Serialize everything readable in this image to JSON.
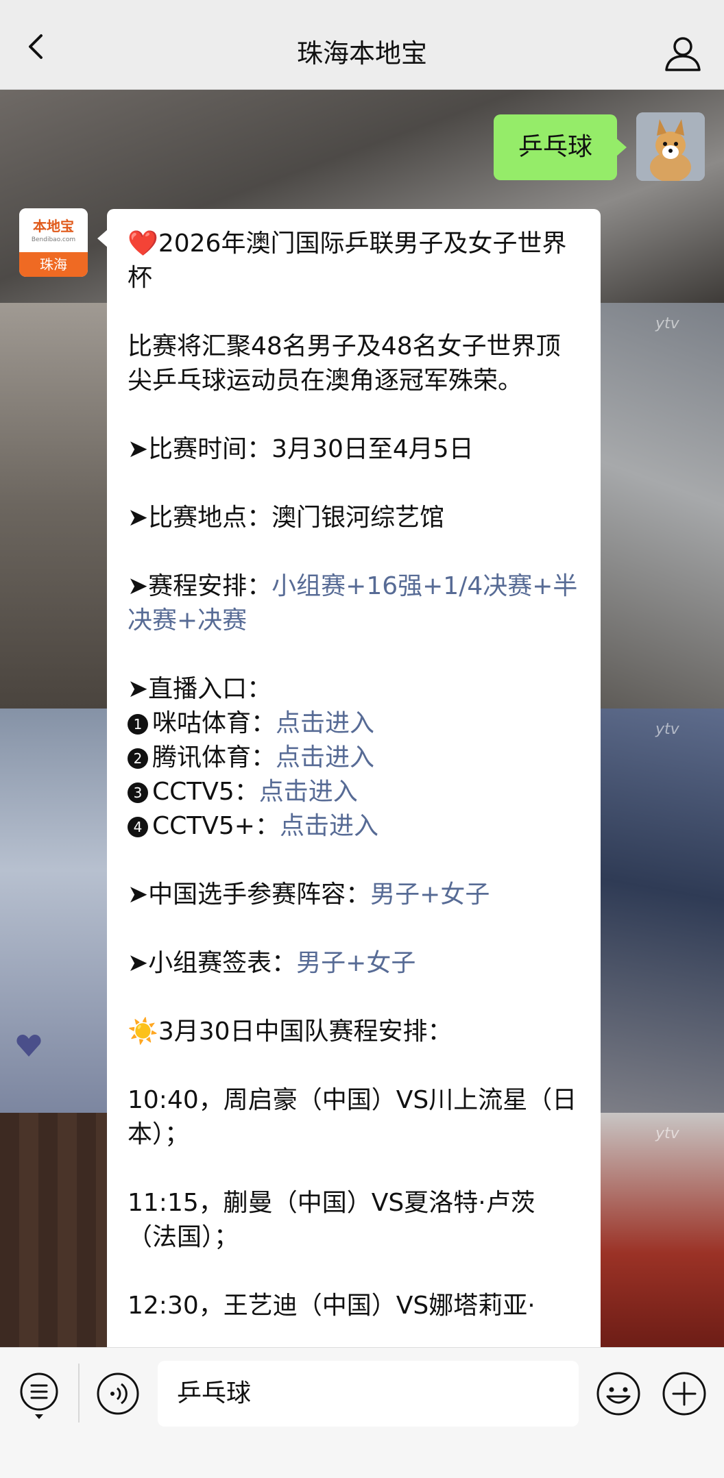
{
  "header": {
    "title": "珠海本地宝",
    "back_icon": "chevron-left-icon",
    "profile_icon": "person-icon"
  },
  "background": {
    "watermark": "ytv"
  },
  "user_message": {
    "text": "乒乓球"
  },
  "bot": {
    "avatar_top": "本地宝",
    "avatar_domain": "Bendibao.com",
    "avatar_bottom": "珠海"
  },
  "message": {
    "title_emoji": "❤️",
    "title": "2026年澳门国际乒联男子及女子世界杯",
    "intro": "比赛将汇聚48名男子及48名女子世界顶尖乒乓球运动员在澳角逐冠军殊荣。",
    "time_label": "➤比赛时间：",
    "time_value": "3月30日至4月5日",
    "venue_label": "➤比赛地点：",
    "venue_value": "澳门银河综艺馆",
    "schedule_label": "➤赛程安排：",
    "schedule_link": "小组赛+16强+1/4决赛+半决赛+决赛",
    "live_label": "➤直播入口：",
    "live_items": [
      {
        "num": "1",
        "name": "咪咕体育：",
        "link": "点击进入"
      },
      {
        "num": "2",
        "name": "腾讯体育：",
        "link": "点击进入"
      },
      {
        "num": "3",
        "name": "CCTV5：",
        "link": "点击进入"
      },
      {
        "num": "4",
        "name": "CCTV5+：",
        "link": "点击进入"
      }
    ],
    "lineup_label": "➤中国选手参赛阵容：",
    "lineup_link": "男子+女子",
    "draw_label": "➤小组赛签表：",
    "draw_link": "男子+女子",
    "sun_emoji": "☀️",
    "day_title": "3月30日中国队赛程安排：",
    "matches": [
      "10:40，周启豪（中国）VS川上流星（日本）；",
      "11:15，蒯曼（中国）VS夏洛特·卢茨（法国）；",
      "12:30，王艺迪（中国）VS娜塔莉亚·"
    ]
  },
  "input_bar": {
    "menu_icon": "list-menu-icon",
    "voice_icon": "voice-icon",
    "value": "乒乓球",
    "emoji_icon": "emoji-smile-icon",
    "plus_icon": "plus-circle-icon"
  }
}
